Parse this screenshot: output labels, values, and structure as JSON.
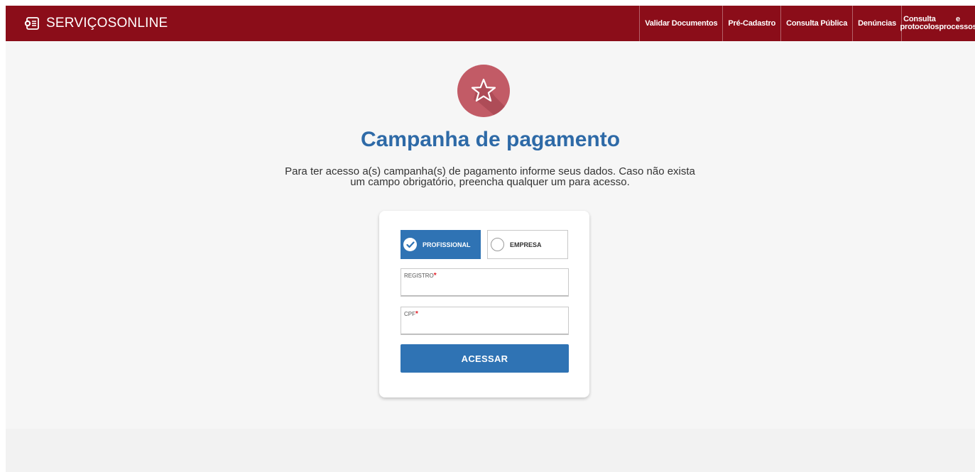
{
  "brand": {
    "name": "SERVIÇOSONLINE",
    "icon": "document-logo-icon"
  },
  "nav": {
    "items": [
      {
        "label": "Validar Documentos"
      },
      {
        "label": "Pré-Cadastro"
      },
      {
        "label": "Consulta Pública"
      },
      {
        "label": "Denúncias"
      },
      {
        "label_line1": "Consulta protocolos",
        "label_line2": "e processos"
      }
    ]
  },
  "hero": {
    "icon": "star-icon",
    "title": "Campanha de pagamento",
    "subtitle_line1": "Para ter acesso a(s) campanha(s) de pagamento informe seus dados. Caso não exista",
    "subtitle_line2": "um campo obrigatório, preencha qualquer um para acesso."
  },
  "form": {
    "type_options": [
      {
        "label": "PROFISSIONAL",
        "selected": true
      },
      {
        "label": "EMPRESA",
        "selected": false
      }
    ],
    "registro": {
      "label": "REGISTRO",
      "required_mark": "*",
      "value": ""
    },
    "cpf": {
      "label": "CPF",
      "required_mark": "*",
      "value": ""
    },
    "submit_label": "ACESSAR"
  },
  "colors": {
    "topbar": "#8b0d19",
    "accent": "#2f73b4",
    "title": "#2e6aa7",
    "badge": "#c25b66",
    "required": "#e01b24"
  }
}
